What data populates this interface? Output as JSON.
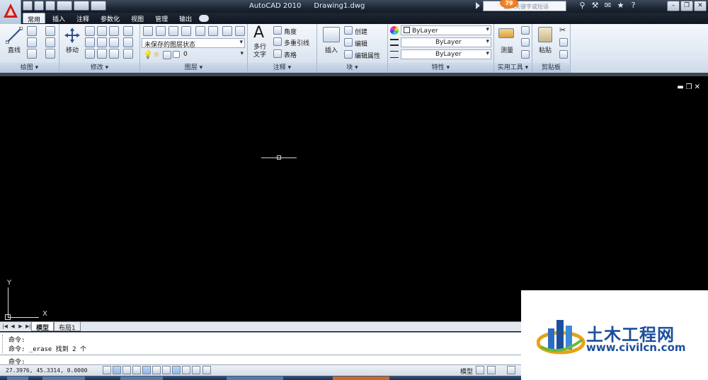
{
  "window": {
    "app_title": "AutoCAD 2010",
    "doc_title": "Drawing1.dwg",
    "search_placeholder": "键入关键字或短语",
    "notification_count": "79"
  },
  "menu_tabs": [
    "常用",
    "插入",
    "注释",
    "参数化",
    "视图",
    "管理",
    "输出"
  ],
  "active_tab": "常用",
  "ribbon": {
    "draw": {
      "title": "绘图",
      "line_label": "直线"
    },
    "modify": {
      "title": "修改",
      "move_label": "移动"
    },
    "layers": {
      "title": "图层",
      "layer_state": "未保存的图层状态",
      "layer_name": "0"
    },
    "annotation": {
      "title": "注释",
      "mtext_label": "多行文字",
      "angle_label": "角度",
      "mleader_label": "多重引线",
      "table_label": "表格"
    },
    "block": {
      "title": "块",
      "insert_label": "插入",
      "create_label": "创建",
      "edit_label": "编辑",
      "edit_attr_label": "编辑属性"
    },
    "properties": {
      "title": "特性",
      "color": "ByLayer",
      "linetype": "ByLayer",
      "lineweight": "ByLayer"
    },
    "utilities": {
      "title": "实用工具",
      "measure_label": "测量"
    },
    "clipboard": {
      "title": "剪贴板",
      "paste_label": "粘贴"
    }
  },
  "ucs": {
    "x_label": "X",
    "y_label": "Y"
  },
  "layout_tabs": [
    "模型",
    "布局1"
  ],
  "command": {
    "history": [
      "命令:",
      "命令: _erase 找到 2 个"
    ],
    "prompt": "命令:"
  },
  "status": {
    "coordinates": "27.3976,  45.3314, 0.0000",
    "model_label": "模型"
  },
  "watermark": {
    "cn_text": "土木工程网",
    "url": "www.civilcn.com"
  },
  "colors": {
    "ribbon_bg": "#dde6f1",
    "title_bar": "#1e2836",
    "drawing_bg": "#000000",
    "watermark_blue": "#1c4f9c",
    "badge_orange": "#e06410"
  }
}
